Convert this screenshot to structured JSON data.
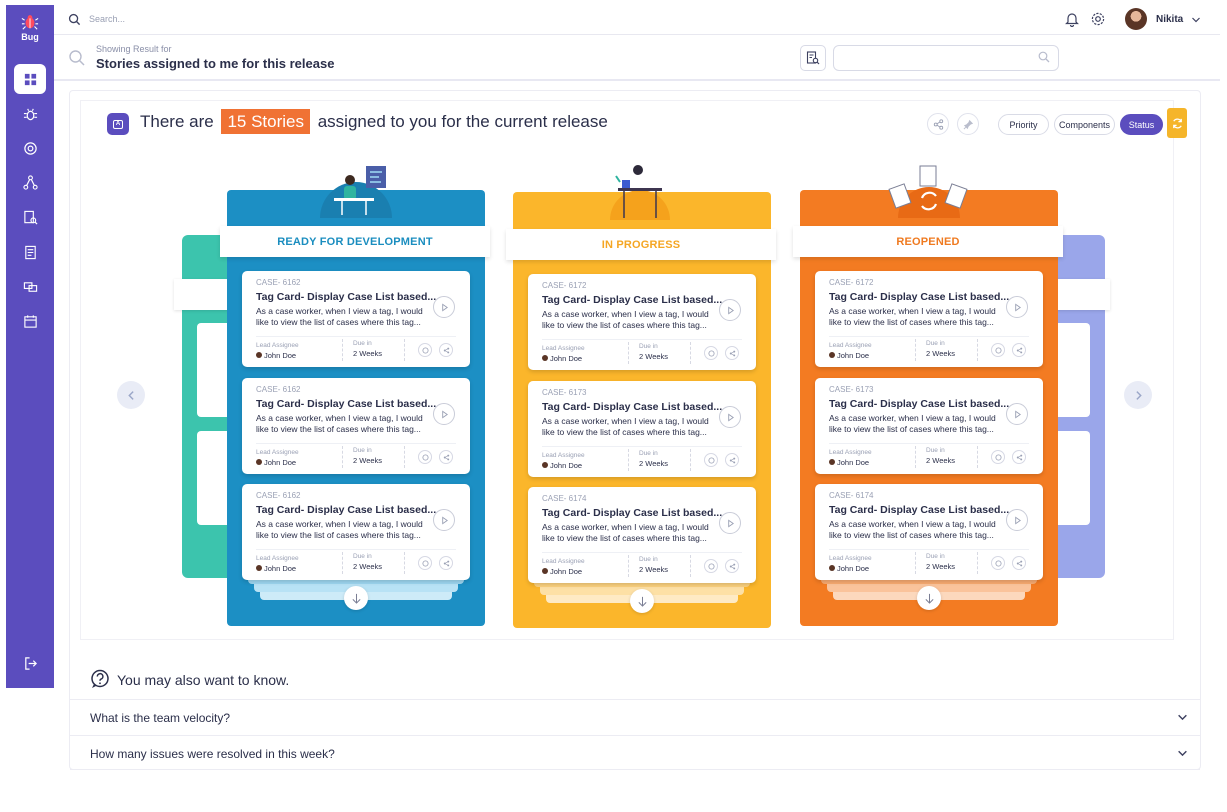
{
  "app": {
    "logo_text": "Bug"
  },
  "topbar": {
    "search_placeholder": "Search...",
    "user_name": "Nikita"
  },
  "subheader": {
    "showing_label": "Showing Result for",
    "title": "Stories assigned to me for this release",
    "search_value": ""
  },
  "headline": {
    "prefix": "There are",
    "highlight": "15 Stories",
    "suffix": "assigned to you for the current release"
  },
  "filters": {
    "priority": "Priority",
    "components": "Components",
    "status": "Status"
  },
  "columns": [
    {
      "name": "READY FOR DEVELOPMENT",
      "color": "#1c8fc4",
      "header_color": "#1a8dbf",
      "cards": [
        {
          "case_id": "CASE- 6162",
          "title": "Tag Card- Display Case List based...",
          "desc": "As a case worker, when I view a tag, I would like to view the list of cases where this tag...",
          "lead_label": "Lead Assignee",
          "lead": "John Doe",
          "due_label": "Due in",
          "due": "2 Weeks"
        },
        {
          "case_id": "CASE- 6162",
          "title": "Tag Card- Display Case List based...",
          "desc": "As a case worker, when I view a tag, I would like to view the list of cases where this tag...",
          "lead_label": "Lead Assignee",
          "lead": "John Doe",
          "due_label": "Due in",
          "due": "2 Weeks"
        },
        {
          "case_id": "CASE- 6162",
          "title": "Tag Card- Display Case List based...",
          "desc": "As a case worker, when I view a tag, I would like to view the list of cases where this tag...",
          "lead_label": "Lead Assignee",
          "lead": "John Doe",
          "due_label": "Due in",
          "due": "2 Weeks"
        }
      ]
    },
    {
      "name": "IN PROGRESS",
      "color": "#fbb62b",
      "header_color": "#f5a623",
      "cards": [
        {
          "case_id": "CASE- 6172",
          "title": "Tag Card- Display Case List based...",
          "desc": "As a case worker, when I view a tag, I would like to view the list of cases where this tag...",
          "lead_label": "Lead Assignee",
          "lead": "John Doe",
          "due_label": "Due in",
          "due": "2 Weeks"
        },
        {
          "case_id": "CASE- 6173",
          "title": "Tag Card- Display Case List based...",
          "desc": "As a case worker, when I view a tag, I would like to view the list of cases where this tag...",
          "lead_label": "Lead Assignee",
          "lead": "John Doe",
          "due_label": "Due in",
          "due": "2 Weeks"
        },
        {
          "case_id": "CASE- 6174",
          "title": "Tag Card- Display Case List based...",
          "desc": "As a case worker, when I view a tag, I would like to view the list of cases where this tag...",
          "lead_label": "Lead Assignee",
          "lead": "John Doe",
          "due_label": "Due in",
          "due": "2 Weeks"
        }
      ]
    },
    {
      "name": "REOPENED",
      "color": "#f37b22",
      "header_color": "#ef7a20",
      "cards": [
        {
          "case_id": "CASE- 6172",
          "title": "Tag Card- Display Case List based...",
          "desc": "As a case worker, when I view a tag, I would like to view the list of cases where this tag...",
          "lead_label": "Lead Assignee",
          "lead": "John Doe",
          "due_label": "Due in",
          "due": "2 Weeks"
        },
        {
          "case_id": "CASE- 6173",
          "title": "Tag Card- Display Case List based...",
          "desc": "As a case worker, when I view a tag, I would like to view the list of cases where this tag...",
          "lead_label": "Lead Assignee",
          "lead": "John Doe",
          "due_label": "Due in",
          "due": "2 Weeks"
        },
        {
          "case_id": "CASE- 6174",
          "title": "Tag Card- Display Case List based...",
          "desc": "As a case worker, when I view a tag, I would like to view the list of cases where this tag...",
          "lead_label": "Lead Assignee",
          "lead": "John Doe",
          "due_label": "Due in",
          "due": "2 Weeks"
        }
      ]
    }
  ],
  "faq": {
    "title": "You may also want to know.",
    "questions": [
      "What is the team velocity?",
      "How many issues were resolved in this week?"
    ]
  },
  "colors": {
    "sidebar": "#5b4dbe",
    "accent": "#5b4dbe",
    "highlight": "#f07234",
    "teal": "#3cc4ad",
    "lavender": "#9aa6ea"
  }
}
